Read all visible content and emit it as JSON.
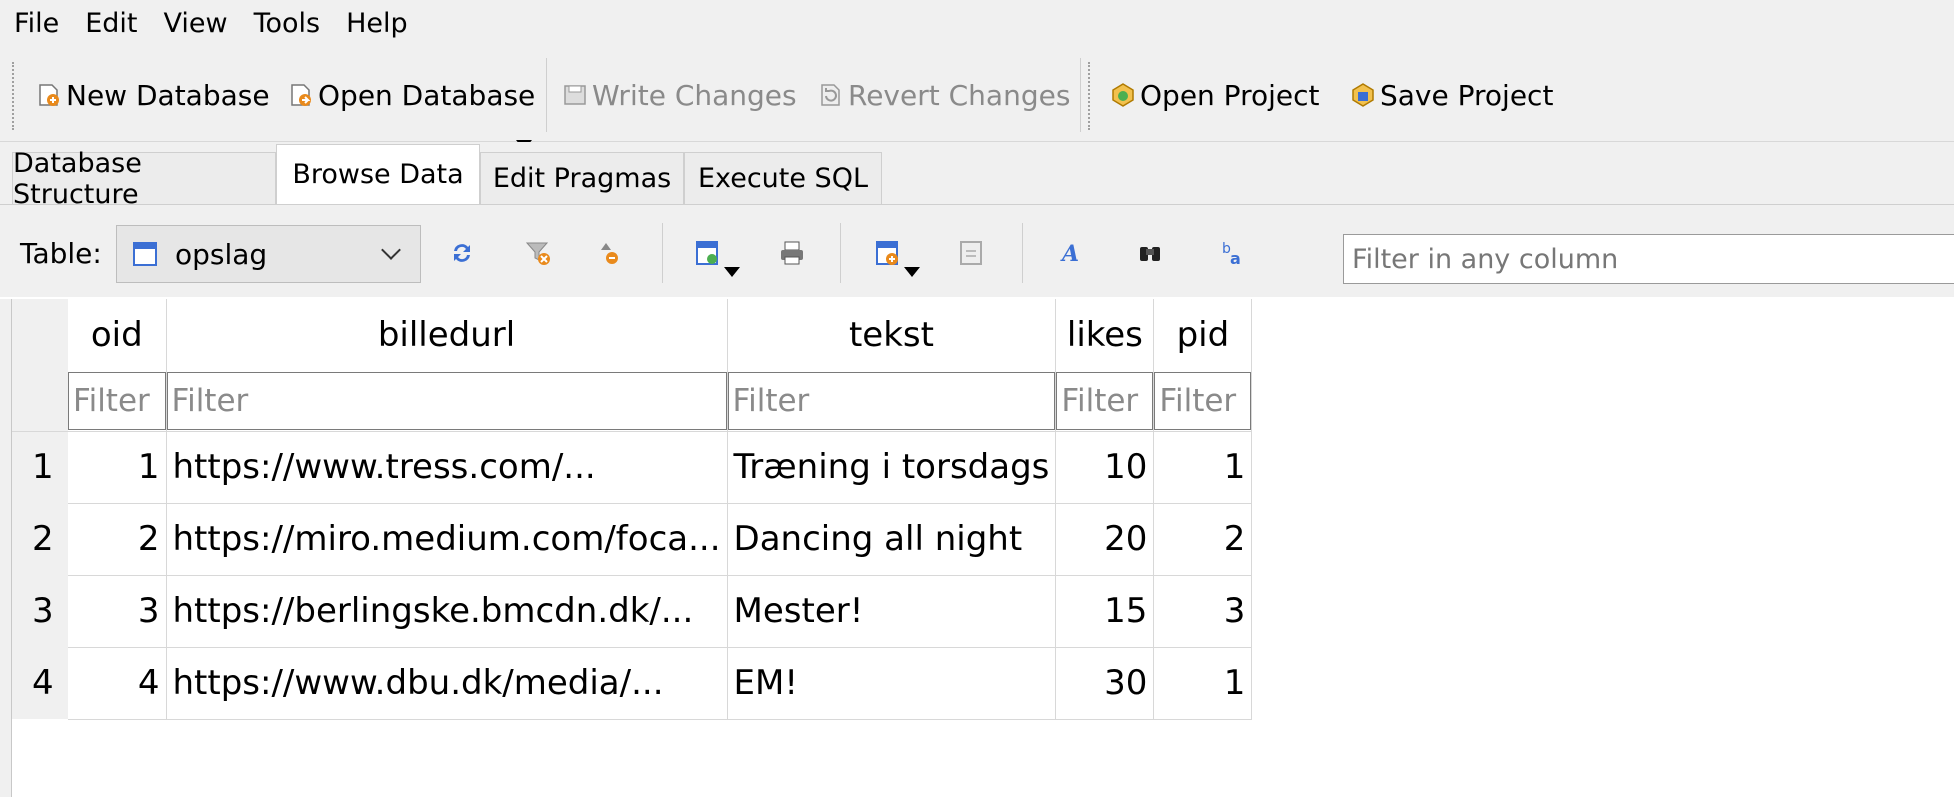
{
  "menu": [
    "File",
    "Edit",
    "View",
    "Tools",
    "Help"
  ],
  "toolbar": {
    "new_database": "New Database",
    "open_database": "Open Database",
    "write_changes": "Write Changes",
    "revert_changes": "Revert Changes",
    "open_project": "Open Project",
    "save_project": "Save Project"
  },
  "tabs": [
    "Database Structure",
    "Browse Data",
    "Edit Pragmas",
    "Execute SQL"
  ],
  "browse": {
    "table_label": "Table:",
    "table_value": "opslag",
    "filter_any_placeholder": "Filter in any column"
  },
  "grid": {
    "columns": [
      "oid",
      "billedurl",
      "tekst",
      "likes",
      "pid"
    ],
    "filter_placeholder": "Filter",
    "rows": [
      {
        "n": "1",
        "oid": "1",
        "billedurl": "https://www.tress.com/...",
        "tekst": "Træning i torsdags",
        "likes": "10",
        "pid": "1"
      },
      {
        "n": "2",
        "oid": "2",
        "billedurl": "https://miro.medium.com/foca...",
        "tekst": "Dancing all night",
        "likes": "20",
        "pid": "2"
      },
      {
        "n": "3",
        "oid": "3",
        "billedurl": "https://berlingske.bmcdn.dk/...",
        "tekst": "Mester!",
        "likes": "15",
        "pid": "3"
      },
      {
        "n": "4",
        "oid": "4",
        "billedurl": "https://www.dbu.dk/media/...",
        "tekst": "EM!",
        "likes": "30",
        "pid": "1"
      }
    ]
  },
  "colors": {
    "accent_blue": "#3b6fd4",
    "accent_orange": "#e98a1c",
    "disabled": "#8a8a8a"
  }
}
